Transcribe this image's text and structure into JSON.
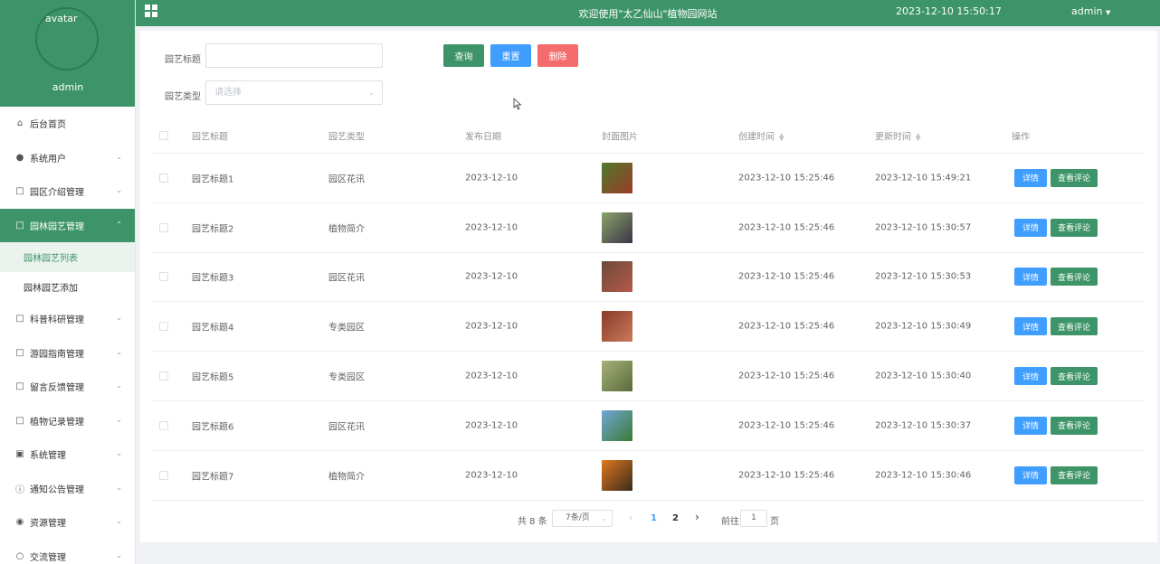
{
  "sidebar": {
    "avatar_alt": "avatar",
    "username": "admin",
    "items": [
      {
        "label": "后台首页",
        "icon": "home-icon"
      },
      {
        "label": "系统用户",
        "icon": "user-icon"
      },
      {
        "label": "园区介绍管理",
        "icon": "document-icon"
      },
      {
        "label": "园林园艺管理",
        "icon": "document-icon"
      },
      {
        "label": "科普科研管理",
        "icon": "document-icon"
      },
      {
        "label": "游园指南管理",
        "icon": "document-icon"
      },
      {
        "label": "留言反馈管理",
        "icon": "document-icon"
      },
      {
        "label": "植物记录管理",
        "icon": "document-icon"
      },
      {
        "label": "系统管理",
        "icon": "picture-icon"
      },
      {
        "label": "通知公告管理",
        "icon": "info-icon"
      },
      {
        "label": "资源管理",
        "icon": "location-icon"
      },
      {
        "label": "交流管理",
        "icon": "chat-icon"
      }
    ],
    "sub_items": [
      {
        "label": "园林园艺列表"
      },
      {
        "label": "园林园艺添加"
      }
    ]
  },
  "header": {
    "title": "欢迎使用\"太乙仙山\"植物园网站",
    "datetime": "2023-12-10 15:50:17",
    "user": "admin"
  },
  "search": {
    "title_label": "园艺标题",
    "title_value": "",
    "type_label": "园艺类型",
    "type_placeholder": "请选择",
    "query_label": "查询",
    "reset_label": "重置",
    "delete_label": "删除"
  },
  "table": {
    "columns": {
      "title": "园艺标题",
      "type": "园艺类型",
      "date": "发布日期",
      "cover": "封面图片",
      "created": "创建时间",
      "updated": "更新时间",
      "actions": "操作"
    },
    "detail_label": "详情",
    "comment_label": "查看评论",
    "rows": [
      {
        "title": "园艺标题1",
        "type": "园区花讯",
        "date": "2023-12-10",
        "created": "2023-12-10 15:25:46",
        "updated": "2023-12-10 15:49:21",
        "thumb_colors": [
          "#4d7a2a",
          "#9c3b2a"
        ]
      },
      {
        "title": "园艺标题2",
        "type": "植物简介",
        "date": "2023-12-10",
        "created": "2023-12-10 15:25:46",
        "updated": "2023-12-10 15:30:57",
        "thumb_colors": [
          "#8aa36a",
          "#3a3448"
        ]
      },
      {
        "title": "园艺标题3",
        "type": "园区花讯",
        "date": "2023-12-10",
        "created": "2023-12-10 15:25:46",
        "updated": "2023-12-10 15:30:53",
        "thumb_colors": [
          "#6b4a3a",
          "#b55a4a"
        ]
      },
      {
        "title": "园艺标题4",
        "type": "专类园区",
        "date": "2023-12-10",
        "created": "2023-12-10 15:25:46",
        "updated": "2023-12-10 15:30:49",
        "thumb_colors": [
          "#8a3a2a",
          "#c97a5a"
        ]
      },
      {
        "title": "园艺标题5",
        "type": "专类园区",
        "date": "2023-12-10",
        "created": "2023-12-10 15:25:46",
        "updated": "2023-12-10 15:30:40",
        "thumb_colors": [
          "#a6b27a",
          "#5a6a3a"
        ]
      },
      {
        "title": "园艺标题6",
        "type": "园区花讯",
        "date": "2023-12-10",
        "created": "2023-12-10 15:25:46",
        "updated": "2023-12-10 15:30:37",
        "thumb_colors": [
          "#6fa8d8",
          "#3c7a34"
        ]
      },
      {
        "title": "园艺标题7",
        "type": "植物简介",
        "date": "2023-12-10",
        "created": "2023-12-10 15:25:46",
        "updated": "2023-12-10 15:30:46",
        "thumb_colors": [
          "#e07820",
          "#3a2a1a"
        ]
      }
    ]
  },
  "pagination": {
    "total": "共 8 条",
    "page_size": "7条/页",
    "pages": [
      "1",
      "2"
    ],
    "current_page": "1",
    "goto_prefix": "前往",
    "goto_value": "1",
    "goto_suffix": "页"
  },
  "colors": {
    "primary": "#3d9468",
    "blue": "#409eff",
    "danger": "#f56c6c"
  }
}
